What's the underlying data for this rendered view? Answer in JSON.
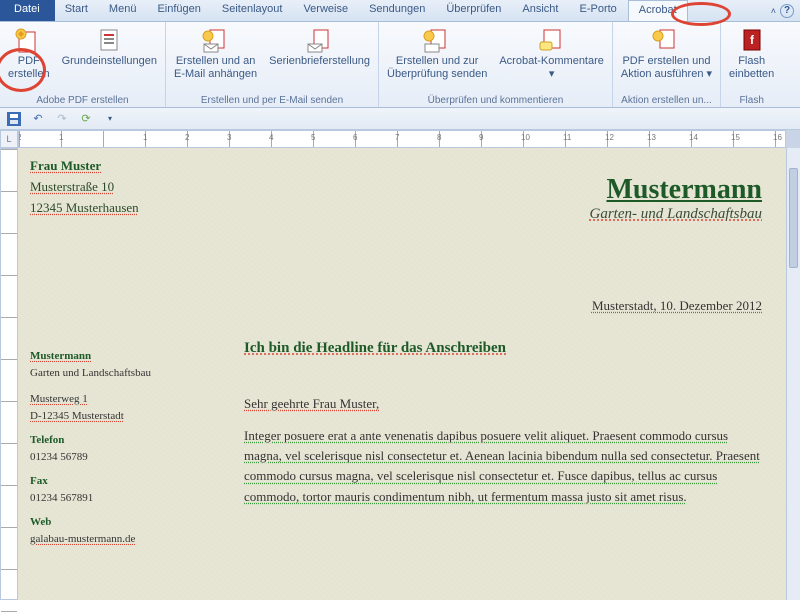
{
  "tabs": {
    "file": "Datei",
    "items": [
      "Start",
      "Menü",
      "Einfügen",
      "Seitenlayout",
      "Verweise",
      "Sendungen",
      "Überprüfen",
      "Ansicht",
      "E-Porto",
      "Acrobat"
    ],
    "active": "Acrobat"
  },
  "ribbon": {
    "groups": [
      {
        "label": "Adobe PDF erstellen",
        "buttons": [
          {
            "label1": "PDF",
            "label2": "erstellen",
            "icon": "pdf"
          },
          {
            "label1": "Grundeinstellungen",
            "label2": "",
            "icon": "gear"
          }
        ]
      },
      {
        "label": "Erstellen und per E-Mail senden",
        "buttons": [
          {
            "label1": "Erstellen und an",
            "label2": "E-Mail anhängen",
            "icon": "pdfmail"
          },
          {
            "label1": "Serienbrieferstellung",
            "label2": "",
            "icon": "pdfmail2"
          }
        ]
      },
      {
        "label": "Überprüfen und kommentieren",
        "buttons": [
          {
            "label1": "Erstellen und zur",
            "label2": "Überprüfung senden",
            "icon": "pdfreview"
          },
          {
            "label1": "Acrobat-Kommentare",
            "label2": "▾",
            "icon": "comment"
          }
        ]
      },
      {
        "label": "Aktion erstellen un...",
        "buttons": [
          {
            "label1": "PDF erstellen und",
            "label2": "Aktion ausführen ▾",
            "icon": "pdfaction"
          }
        ]
      },
      {
        "label": "Flash",
        "buttons": [
          {
            "label1": "Flash",
            "label2": "einbetten",
            "icon": "flash"
          }
        ]
      }
    ]
  },
  "ruler_h_numbers": [
    "2",
    "1",
    "",
    "1",
    "2",
    "3",
    "4",
    "5",
    "6",
    "7",
    "8",
    "9",
    "10",
    "11",
    "12",
    "13",
    "14",
    "15",
    "16"
  ],
  "document": {
    "recipient": {
      "name": "Frau Muster",
      "street": "Musterstraße 10",
      "city": "12345 Musterhausen"
    },
    "company": {
      "name": "Mustermann",
      "sub": "Garten- und Landschaftsbau"
    },
    "date": "Musterstadt, 10. Dezember 2012",
    "headline": "Ich bin die Headline für das Anschreiben",
    "side": {
      "t1": "Mustermann",
      "t1b": "Garten und Landschaftsbau",
      "addr1": "Musterweg 1",
      "addr2": "D-12345 Musterstadt",
      "tel_h": "Telefon",
      "tel": "01234 56789",
      "fax_h": "Fax",
      "fax": "01234 567891",
      "web_h": "Web",
      "web": "galabau-mustermann.de"
    },
    "salutation": "Sehr geehrte Frau Muster,",
    "para1": "Integer posuere erat a ante venenatis dapibus posuere velit aliquet. Praesent commodo cursus magna, vel scelerisque nisl consectetur et. Aenean lacinia bibendum nulla sed consectetur. Praesent commodo cursus magna, vel scelerisque nisl consectetur et. Fusce dapibus, tellus ac cursus commodo, tortor mauris condimentum nibh, ut fermentum massa justo sit amet risus."
  }
}
